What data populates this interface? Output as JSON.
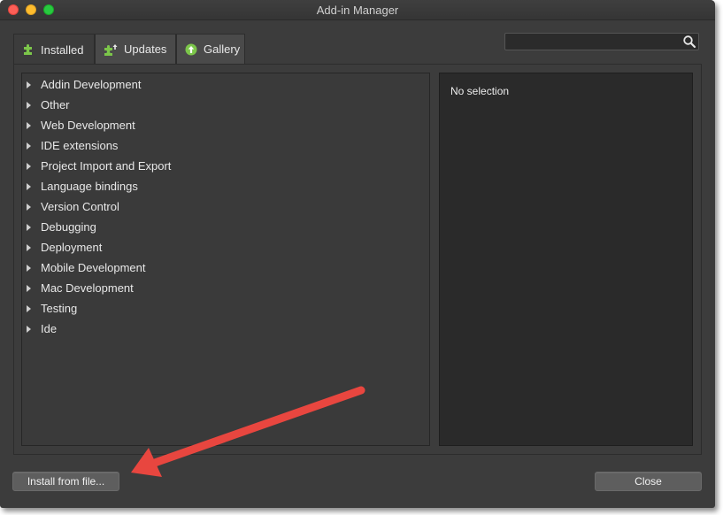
{
  "window": {
    "title": "Add-in Manager"
  },
  "tabs": [
    {
      "label": "Installed",
      "icon": "puzzle-icon",
      "active": true
    },
    {
      "label": "Updates",
      "icon": "puzzle-update-icon",
      "active": false
    },
    {
      "label": "Gallery",
      "icon": "gallery-up-arrow-icon",
      "active": false
    }
  ],
  "search": {
    "value": "",
    "placeholder": ""
  },
  "tree": {
    "items": [
      {
        "label": "Addin Development"
      },
      {
        "label": "Other"
      },
      {
        "label": "Web Development"
      },
      {
        "label": "IDE extensions"
      },
      {
        "label": "Project Import and Export"
      },
      {
        "label": "Language bindings"
      },
      {
        "label": "Version Control"
      },
      {
        "label": "Debugging"
      },
      {
        "label": "Deployment"
      },
      {
        "label": "Mobile Development"
      },
      {
        "label": "Mac Development"
      },
      {
        "label": "Testing"
      },
      {
        "label": "Ide"
      }
    ]
  },
  "details": {
    "empty_text": "No selection"
  },
  "buttons": {
    "install_label": "Install from file...",
    "close_label": "Close"
  },
  "colors": {
    "accent_green": "#7cc64a",
    "annotation_arrow": "#e8463f",
    "window_bg": "#3c3c3c"
  }
}
